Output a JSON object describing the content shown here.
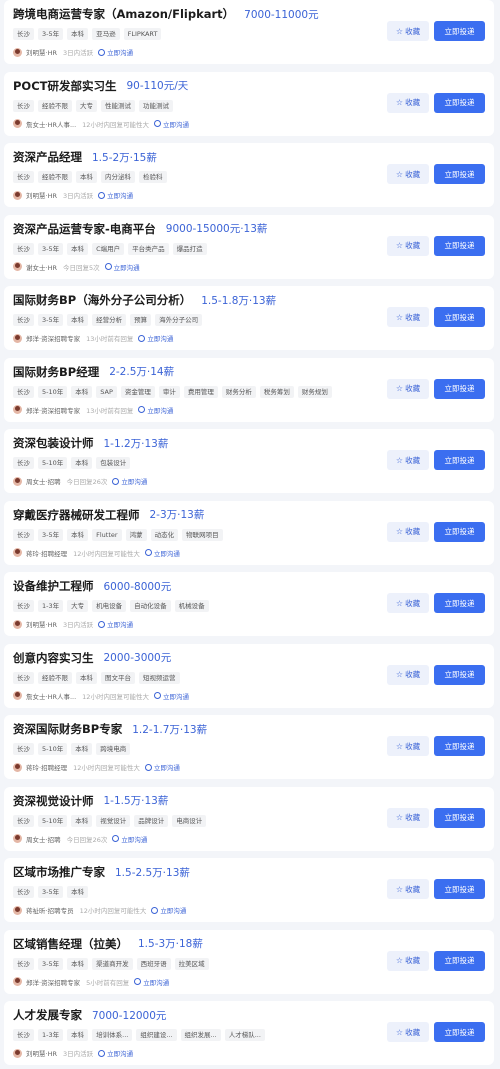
{
  "ui": {
    "fav_label": "收藏",
    "apply_label": "立即投递",
    "chat_label": "立即沟通"
  },
  "jobs": [
    {
      "title": "跨境电商运营专家（Amazon/Flipkart）",
      "salary": "7000-11000元",
      "tags": [
        "长沙",
        "3-5年",
        "本科",
        "亚马逊",
        "FLIPKART"
      ],
      "hr": "刘明慧·HR",
      "status": "3日内活跃"
    },
    {
      "title": "POCT研发部实习生",
      "salary": "90-110元/天",
      "tags": [
        "长沙",
        "经验不限",
        "大专",
        "性能测试",
        "功能测试"
      ],
      "hr": "詹女士·HR人事...",
      "status": "12小时内回复可能性大"
    },
    {
      "title": "资深产品经理",
      "salary": "1.5-2万·15薪",
      "tags": [
        "长沙",
        "经验不限",
        "本科",
        "内分泌科",
        "检验科"
      ],
      "hr": "刘明慧·HR",
      "status": "3日内活跃"
    },
    {
      "title": "资深产品运营专家-电商平台",
      "salary": "9000-15000元·13薪",
      "tags": [
        "长沙",
        "3-5年",
        "本科",
        "C端用户",
        "平台类产品",
        "爆品打造"
      ],
      "hr": "谢女士·HR",
      "status": "今日回复5次"
    },
    {
      "title": "国际财务BP（海外分子公司分析）",
      "salary": "1.5-1.8万·13薪",
      "tags": [
        "长沙",
        "3-5年",
        "本科",
        "经营分析",
        "预算",
        "海外分子公司"
      ],
      "hr": "郑洋·资深招聘专家",
      "status": "13小时前有回复"
    },
    {
      "title": "国际财务BP经理",
      "salary": "2-2.5万·14薪",
      "tags": [
        "长沙",
        "5-10年",
        "本科",
        "SAP",
        "资金管理",
        "审计",
        "费用管理",
        "财务分析",
        "税务筹划",
        "财务规划"
      ],
      "hr": "郑洋·资深招聘专家",
      "status": "13小时前有回复"
    },
    {
      "title": "资深包装设计师",
      "salary": "1-1.2万·13薪",
      "tags": [
        "长沙",
        "5-10年",
        "本科",
        "包装设计"
      ],
      "hr": "周女士·招聘",
      "status": "今日回复26次"
    },
    {
      "title": "穿戴医疗器械研发工程师",
      "salary": "2-3万·13薪",
      "tags": [
        "长沙",
        "3-5年",
        "本科",
        "Flutter",
        "鸿蒙",
        "动态化",
        "物联网项目"
      ],
      "hr": "蒋玲·招聘经理",
      "status": "12小时内回复可能性大"
    },
    {
      "title": "设备维护工程师",
      "salary": "6000-8000元",
      "tags": [
        "长沙",
        "1-3年",
        "大专",
        "机电设备",
        "自动化设备",
        "机械设备"
      ],
      "hr": "刘明慧·HR",
      "status": "3日内活跃"
    },
    {
      "title": "创意内容实习生",
      "salary": "2000-3000元",
      "tags": [
        "长沙",
        "经验不限",
        "本科",
        "图文平台",
        "短视频运营"
      ],
      "hr": "詹女士·HR人事...",
      "status": "12小时内回复可能性大"
    },
    {
      "title": "资深国际财务BP专家",
      "salary": "1.2-1.7万·13薪",
      "tags": [
        "长沙",
        "5-10年",
        "本科",
        "跨境电商"
      ],
      "hr": "蒋玲·招聘经理",
      "status": "12小时内回复可能性大"
    },
    {
      "title": "资深视觉设计师",
      "salary": "1-1.5万·13薪",
      "tags": [
        "长沙",
        "5-10年",
        "本科",
        "视觉设计",
        "品牌设计",
        "电商设计"
      ],
      "hr": "周女士·招聘",
      "status": "今日回复26次"
    },
    {
      "title": "区域市场推广专家",
      "salary": "1.5-2.5万·13薪",
      "tags": [
        "长沙",
        "3-5年",
        "本科"
      ],
      "hr": "蒋祉昕·招聘专员",
      "status": "12小时内回复可能性大"
    },
    {
      "title": "区域销售经理（拉美）",
      "salary": "1.5-3万·18薪",
      "tags": [
        "长沙",
        "3-5年",
        "本科",
        "渠道商开发",
        "西班牙语",
        "拉美区域"
      ],
      "hr": "郑洋·资深招聘专家",
      "status": "5小时前有回复"
    },
    {
      "title": "人才发展专家",
      "salary": "7000-12000元",
      "tags": [
        "长沙",
        "1-3年",
        "本科",
        "培训体系...",
        "组织建设...",
        "组织发展...",
        "人才梯队..."
      ],
      "hr": "刘明慧·HR",
      "status": "3日内活跃"
    }
  ]
}
